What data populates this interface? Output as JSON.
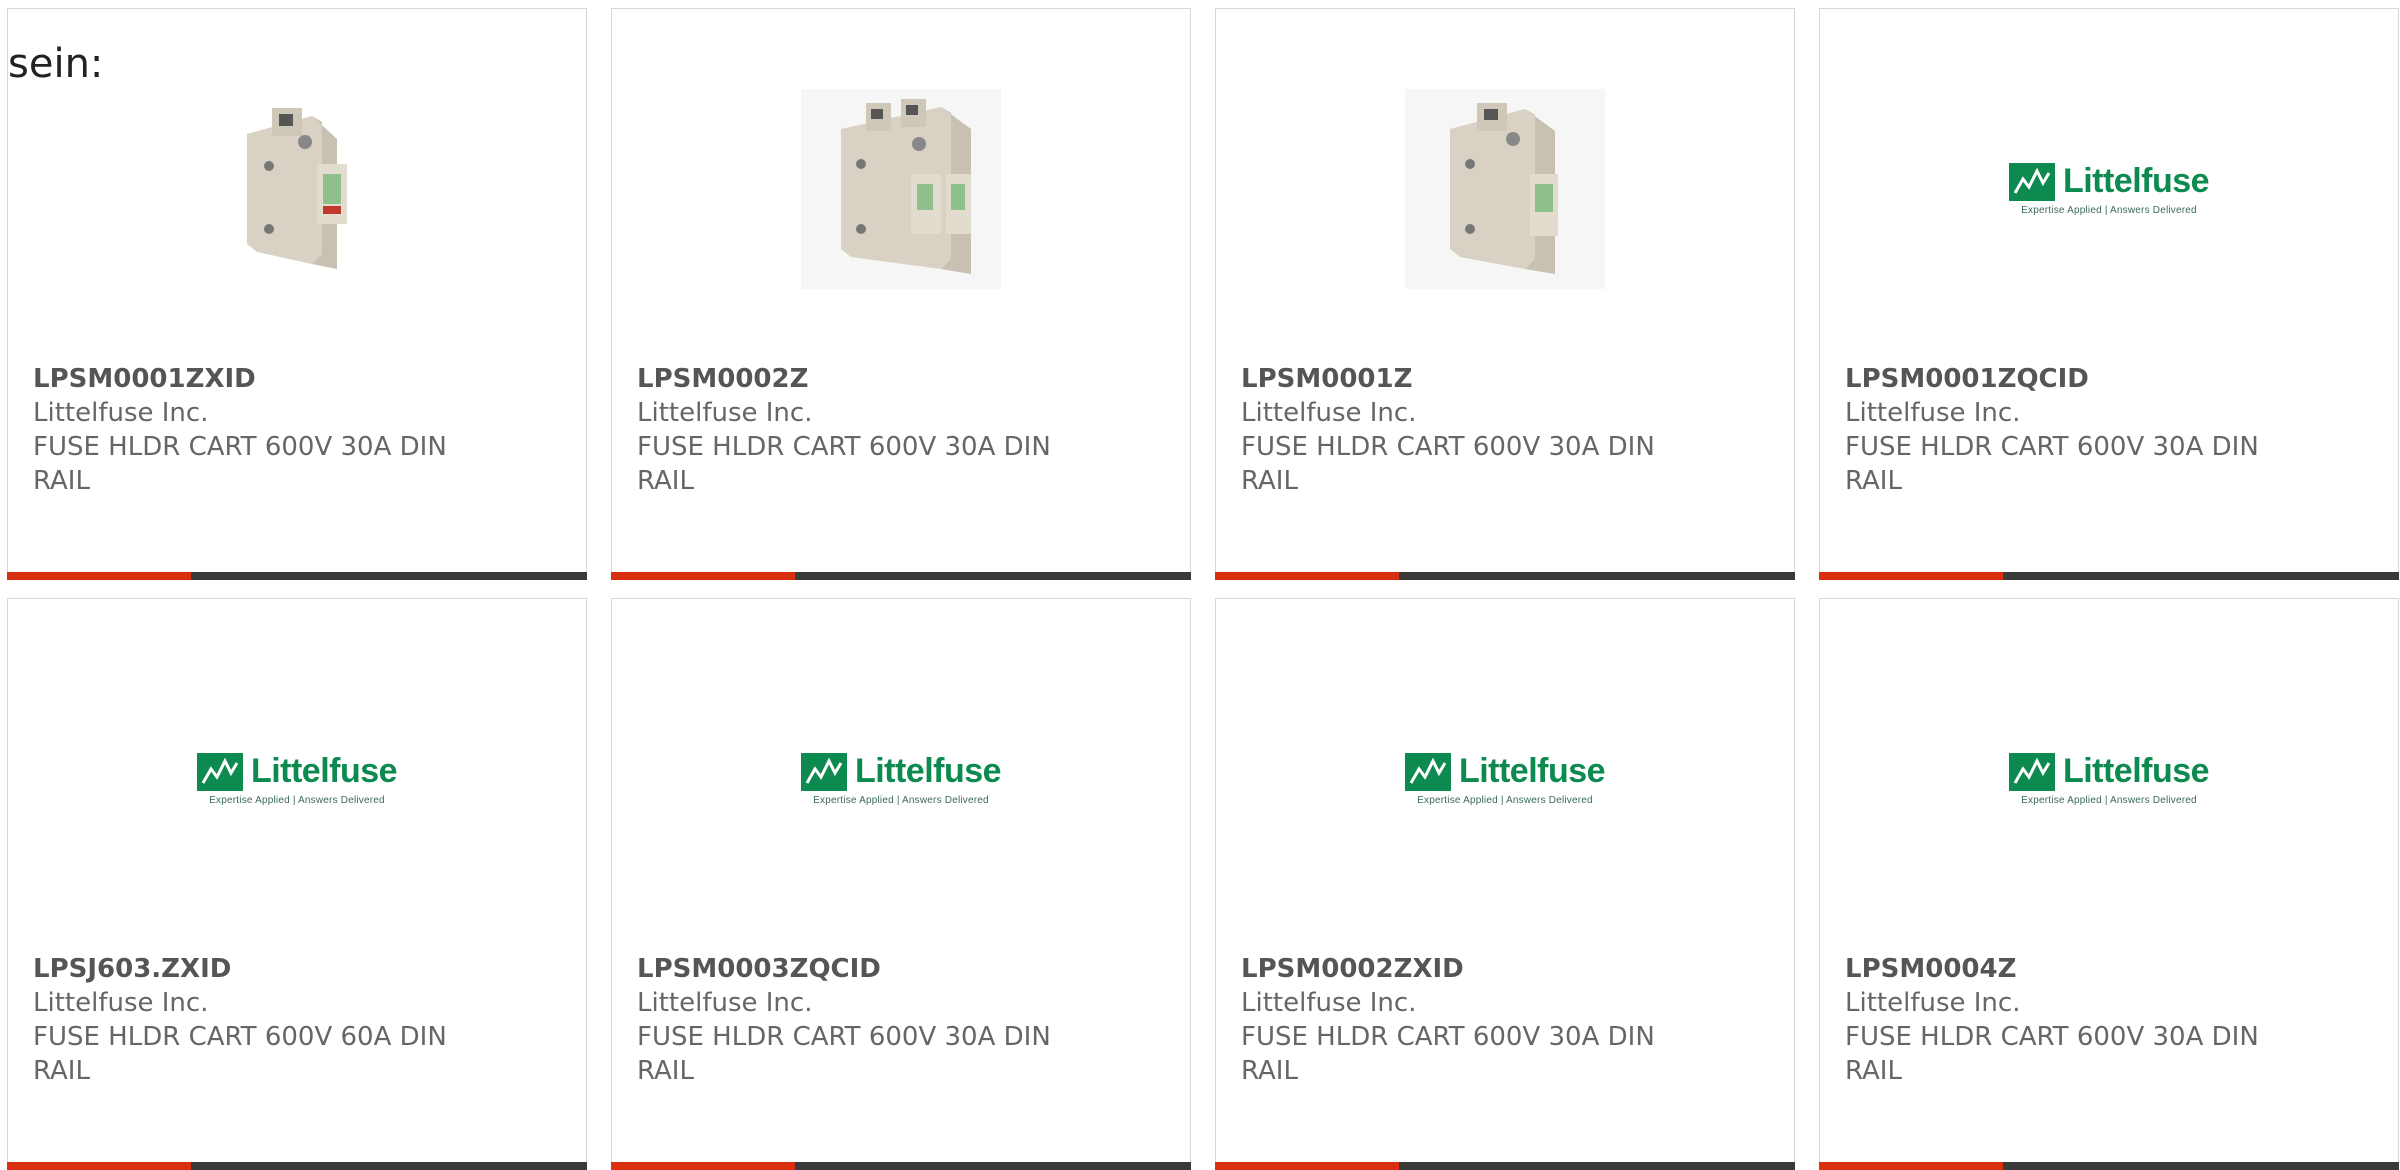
{
  "intro_text": "sein:",
  "logo": {
    "wordmark": "Littelfuse",
    "tagline": "Expertise Applied | Answers Delivered"
  },
  "colors": {
    "accent_bar": "#d8300f",
    "bar": "#3a3a3a",
    "logo_green": "#0d8a50"
  },
  "products": [
    {
      "part": "LPSM0001ZXID",
      "maker": "Littelfuse Inc.",
      "desc": "FUSE HLDR CART 600V 30A DIN RAIL",
      "image": "fuse-holder-1-pole-photo"
    },
    {
      "part": "LPSM0002Z",
      "maker": "Littelfuse Inc.",
      "desc": "FUSE HLDR CART 600V 30A DIN RAIL",
      "image": "fuse-holder-2-pole-photo"
    },
    {
      "part": "LPSM0001Z",
      "maker": "Littelfuse Inc.",
      "desc": "FUSE HLDR CART 600V 30A DIN RAIL",
      "image": "fuse-holder-1-pole-photo"
    },
    {
      "part": "LPSM0001ZQCID",
      "maker": "Littelfuse Inc.",
      "desc": "FUSE HLDR CART 600V 30A DIN RAIL",
      "image": "littelfuse-logo"
    },
    {
      "part": "LPSJ603.ZXID",
      "maker": "Littelfuse Inc.",
      "desc": "FUSE HLDR CART 600V 60A DIN RAIL",
      "image": "littelfuse-logo"
    },
    {
      "part": "LPSM0003ZQCID",
      "maker": "Littelfuse Inc.",
      "desc": "FUSE HLDR CART 600V 30A DIN RAIL",
      "image": "littelfuse-logo"
    },
    {
      "part": "LPSM0002ZXID",
      "maker": "Littelfuse Inc.",
      "desc": "FUSE HLDR CART 600V 30A DIN RAIL",
      "image": "littelfuse-logo"
    },
    {
      "part": "LPSM0004Z",
      "maker": "Littelfuse Inc.",
      "desc": "FUSE HLDR CART 600V 30A DIN RAIL",
      "image": "littelfuse-logo"
    }
  ]
}
